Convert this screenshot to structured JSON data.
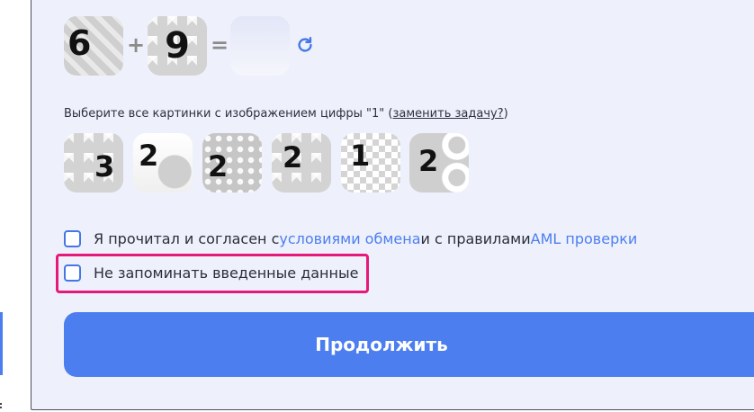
{
  "captcha": {
    "operand1": "6",
    "operator": "+",
    "operand2": "9",
    "equals": "=",
    "answer_value": "",
    "refresh_icon": "refresh-icon"
  },
  "image_task": {
    "instruction_prefix": "Выберите все картинки с изображением цифры \"1\" (",
    "replace_link": "заменить задачу?",
    "instruction_suffix": ")",
    "tiles": [
      {
        "digit": "3"
      },
      {
        "digit": "2"
      },
      {
        "digit": "2"
      },
      {
        "digit": "2"
      },
      {
        "digit": "1"
      },
      {
        "digit": "2"
      }
    ]
  },
  "agreement": {
    "text_before": "Я прочитал и согласен с ",
    "exchange_terms_link": "условиями обмена",
    "text_middle": " и с правилами ",
    "aml_link": "AML проверки",
    "checked": false
  },
  "remember": {
    "label": "Не запоминать введенные данные",
    "checked": false
  },
  "continue_button": {
    "label": "Продолжить"
  },
  "colors": {
    "accent": "#4c7ef0",
    "panel_bg": "#eef1fb",
    "highlight": "#e6197a"
  }
}
